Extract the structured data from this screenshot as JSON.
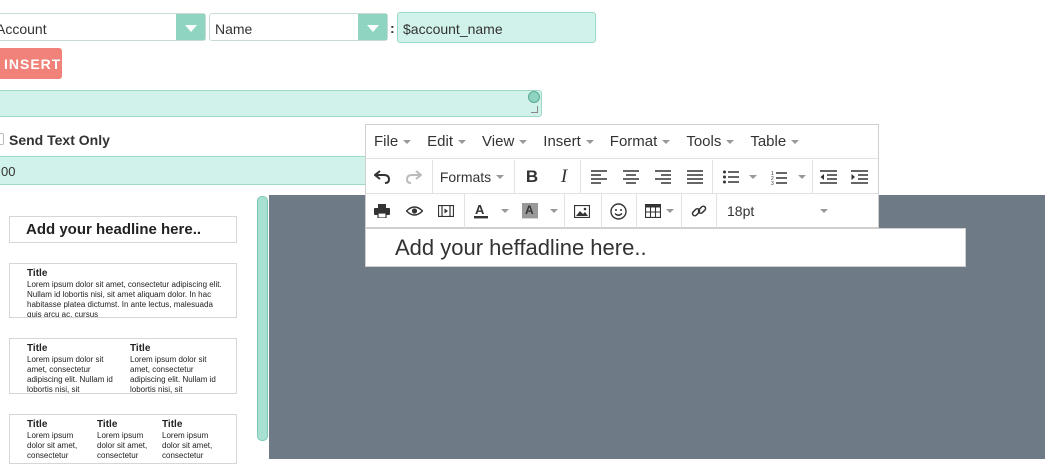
{
  "merge": {
    "module_select": "Account",
    "field_select": "Name",
    "colon": ":",
    "variable": "$account_name",
    "insert_label": "INSERT"
  },
  "send_text_only": {
    "label": "Send Text Only",
    "checked": false
  },
  "numeric_field": {
    "value": "00"
  },
  "editor": {
    "menu": [
      "File",
      "Edit",
      "View",
      "Insert",
      "Format",
      "Tools",
      "Table"
    ],
    "formats_label": "Formats",
    "font_size": "18pt",
    "content": "Add your heffadline here.."
  },
  "templates": {
    "headline": "Add your headline here..",
    "one_col": {
      "title": "Title",
      "body": "Lorem ipsum dolor sit amet, consectetur adipiscing elit. Nullam id lobortis nisi, sit amet aliquam dolor. In hac habitasse platea dictumst. In ante lectus, malesuada quis arcu ac, cursus"
    },
    "two_col": [
      {
        "title": "Title",
        "body": "Lorem ipsum dolor sit amet, consectetur adipiscing elit. Nullam id lobortis nisi, sit"
      },
      {
        "title": "Title",
        "body": "Lorem ipsum dolor sit amet, consectetur adipiscing elit. Nullam id lobortis nisi, sit"
      }
    ],
    "three_col": [
      {
        "title": "Title",
        "body": "Lorem ipsum dolor sit amet, consectetur"
      },
      {
        "title": "Title",
        "body": "Lorem ipsum dolor sit amet, consectetur"
      },
      {
        "title": "Title",
        "body": "Lorem ipsum dolor sit amet, consectetur"
      }
    ]
  },
  "colors": {
    "accent_teal": "#8ed4c1",
    "field_bg": "#d1f2ea",
    "insert_button": "#f08279",
    "canvas_bg": "#6e7a85"
  }
}
